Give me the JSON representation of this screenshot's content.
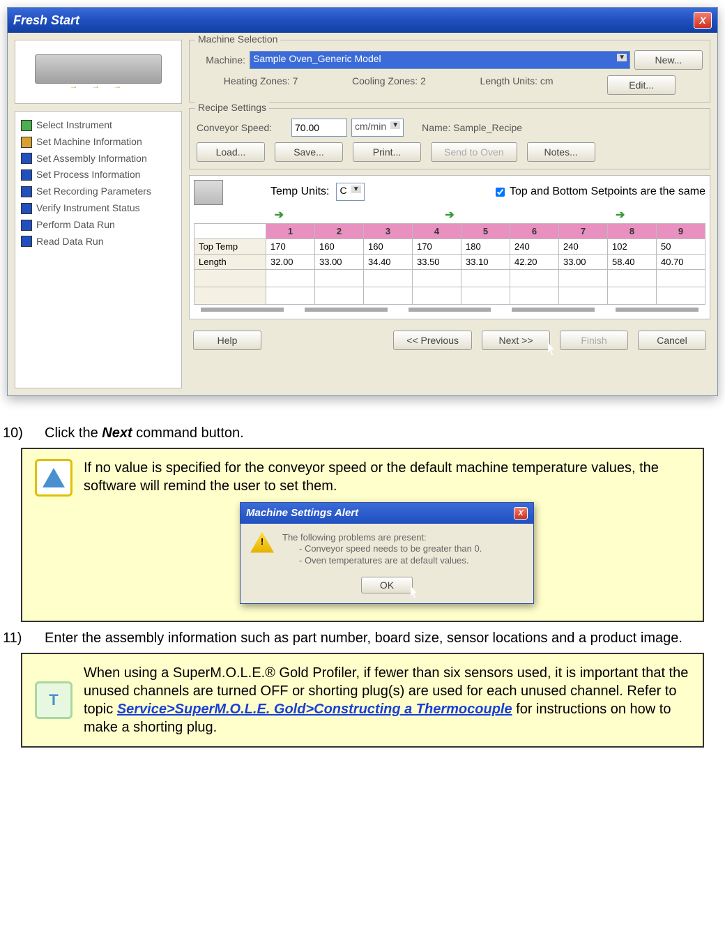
{
  "window": {
    "title": "Fresh Start",
    "close": "X"
  },
  "checklist": [
    {
      "color": "green",
      "label": "Select Instrument"
    },
    {
      "color": "amber",
      "label": "Set Machine Information"
    },
    {
      "color": "blue",
      "label": "Set Assembly Information"
    },
    {
      "color": "blue",
      "label": "Set Process Information"
    },
    {
      "color": "blue",
      "label": "Set Recording Parameters"
    },
    {
      "color": "blue",
      "label": "Verify Instrument Status"
    },
    {
      "color": "blue",
      "label": "Perform Data Run"
    },
    {
      "color": "blue",
      "label": "Read Data Run"
    }
  ],
  "machine": {
    "group": "Machine Selection",
    "machine_label": "Machine:",
    "machine_value": "Sample Oven_Generic Model",
    "new_btn": "New...",
    "heating": "Heating Zones: 7",
    "cooling": "Cooling Zones: 2",
    "units": "Length Units: cm",
    "edit_btn": "Edit..."
  },
  "recipe": {
    "group": "Recipe Settings",
    "speed_label": "Conveyor Speed:",
    "speed_value": "70.00",
    "speed_units": "cm/min",
    "name_label": "Name: Sample_Recipe",
    "load_btn": "Load...",
    "save_btn": "Save...",
    "print_btn": "Print...",
    "disabled_btn": "Send to Oven",
    "notes_btn": "Notes..."
  },
  "zones": {
    "temp_units_label": "Temp Units:",
    "temp_units_value": "C",
    "checkbox_label": "Top and Bottom Setpoints are the same",
    "headers": [
      "1",
      "2",
      "3",
      "4",
      "5",
      "6",
      "7",
      "8",
      "9"
    ],
    "row1_label": "Top Temp",
    "row1": [
      "170",
      "160",
      "160",
      "170",
      "180",
      "240",
      "240",
      "102",
      "50"
    ],
    "row2_label": "Length",
    "row2": [
      "32.00",
      "33.00",
      "34.40",
      "33.50",
      "33.10",
      "42.20",
      "33.00",
      "58.40",
      "40.70"
    ]
  },
  "nav": {
    "help": "Help",
    "prev": "<< Previous",
    "next": "Next >>",
    "finish": "Finish",
    "cancel": "Cancel"
  },
  "doc": {
    "step10_num": "10)",
    "step10": "Click the ",
    "step10_bold": "Next",
    "step10_end": " command button.",
    "note1": "If no value is specified for the conveyor speed or the default machine temperature values, the software will remind the user to set them.",
    "alert_title": "Machine Settings Alert",
    "alert_heading": "The following problems are present:",
    "alert_line1": "- Conveyor speed needs to be greater than 0.",
    "alert_line2": "- Oven temperatures are at default values.",
    "alert_ok": "OK",
    "step11_num": "11)",
    "step11": "Enter the assembly information such as part number, board size, sensor locations and a product image.",
    "note2_a": "When using a SuperM.O.L.E.® Gold Profiler, if fewer than six sensors used, it is important that the unused channels are turned OFF or shorting plug(s) are used for each unused channel. Refer to topic ",
    "note2_link": "Service>SuperM.O.L.E. Gold>Constructing a Thermocouple",
    "note2_b": " for instructions on how to make a shorting plug."
  }
}
